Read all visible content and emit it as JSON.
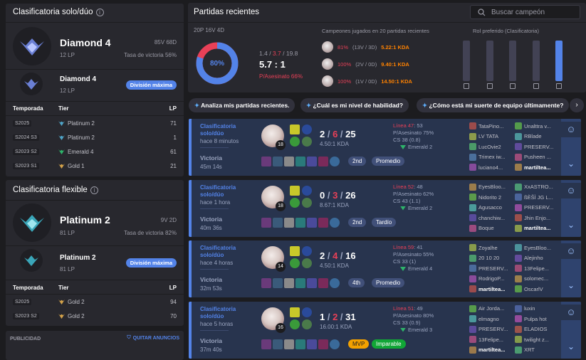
{
  "solo": {
    "title": "Clasificatoria solo/dúo",
    "rank": "Diamond 4",
    "lp": "12 LP",
    "wl": "85V 68D",
    "winrate": "Tasa de victoria 56%",
    "sub_rank": "Diamond 4",
    "sub_lp": "12 LP",
    "badge": "División máxima",
    "headers": {
      "season": "Temporada",
      "tier": "Tier",
      "lp": "LP"
    },
    "seasons": [
      {
        "season": "S2025",
        "tier": "Platinum 2",
        "lp": "71",
        "color": "#4fa3c6"
      },
      {
        "season": "S2024 S3",
        "tier": "Platinum 2",
        "lp": "1",
        "color": "#4fa3c6"
      },
      {
        "season": "S2023 S2",
        "tier": "Emerald 4",
        "lp": "61",
        "color": "#2eb36a"
      },
      {
        "season": "S2023 S1",
        "tier": "Gold 1",
        "lp": "21",
        "color": "#d3a24a"
      }
    ]
  },
  "flex": {
    "title": "Clasificatoria flexible",
    "rank": "Platinum 2",
    "lp": "81 LP",
    "wl": "9V 2D",
    "winrate": "Tasa de victoria 82%",
    "sub_rank": "Platinum 2",
    "sub_lp": "81 LP",
    "badge": "División máxima",
    "headers": {
      "season": "Temporada",
      "tier": "Tier",
      "lp": "LP"
    },
    "seasons": [
      {
        "season": "S2025",
        "tier": "Gold 2",
        "lp": "94",
        "color": "#d3a24a"
      },
      {
        "season": "S2023 S2",
        "tier": "Gold 2",
        "lp": "70",
        "color": "#d3a24a"
      }
    ]
  },
  "ads": {
    "label": "PUBLICIDAD",
    "remove": "QUITAR ANUNCIOS"
  },
  "recent": {
    "title": "Partidas recientes",
    "search_placeholder": "Buscar campeón",
    "record": "20P 16V 4D",
    "winrate": "80%",
    "kills": "1.4",
    "deaths": "3.7",
    "assists": "19.8",
    "kda": "5.7 : 1",
    "kp": "P/Asesinato 66%",
    "champs_title": "Campeones jugados en 20 partidas recientes",
    "champs": [
      {
        "pct": "81%",
        "rec": "(13V / 3D)",
        "kda": "5.22:1 KDA",
        "pct_color": "#e84057",
        "kda_color": "#ff8200"
      },
      {
        "pct": "100%",
        "rec": "(2V / 0D)",
        "kda": "9.40:1 KDA",
        "pct_color": "#e84057",
        "kda_color": "#ff8200"
      },
      {
        "pct": "100%",
        "rec": "(1V / 0D)",
        "kda": "14.50:1 KDA",
        "pct_color": "#e84057",
        "kda_color": "#ff8200"
      }
    ],
    "role_title": "Rol preferido (Clasificatoria)",
    "roles": [
      {
        "name": "top",
        "share": 0
      },
      {
        "name": "jungle",
        "share": 0
      },
      {
        "name": "mid",
        "share": 0
      },
      {
        "name": "adc",
        "share": 0
      },
      {
        "name": "support",
        "share": 1
      }
    ]
  },
  "chips": [
    "Analiza mis partidas recientes.",
    "¿Cuál es mi nivel de habilidad?",
    "¿Cómo está mi suerte de equipo últimamente?"
  ],
  "games": [
    {
      "queue": "Clasificatoria solo/dúo",
      "ago": "hace 8 minutos",
      "result": "Victoria",
      "duration": "45m 14s",
      "level": "18",
      "k": "2",
      "d": "6",
      "a": "25",
      "kda": "4.50:1 KDA",
      "tags": [
        {
          "t": "2nd",
          "bg": "#415079",
          "c": "#fff"
        },
        {
          "t": "Promedio",
          "bg": "#415079",
          "c": "#fff"
        }
      ],
      "line_label": "Línea 47",
      "line_rest": ": 53",
      "kp": "P/Asesinato 75%",
      "cs": "CS 38 (0.8)",
      "rank": "Emerald 2",
      "team1": [
        "TataPino...",
        "LV TATA",
        "LucOvie2",
        "Trimex iw...",
        "luciano4..."
      ],
      "team2": [
        "Unalttra v...",
        "RBlade",
        "PRESERV...",
        "Pusheen ...",
        "martiltea..."
      ]
    },
    {
      "queue": "Clasificatoria solo/dúo",
      "ago": "hace 1 hora",
      "result": "Victoria",
      "duration": "40m 36s",
      "level": "18",
      "k": "0",
      "d": "3",
      "a": "26",
      "kda": "8.67:1 KDA",
      "tags": [
        {
          "t": "2nd",
          "bg": "#415079",
          "c": "#fff"
        },
        {
          "t": "Tardío",
          "bg": "#415079",
          "c": "#fff"
        }
      ],
      "line_label": "Línea 52",
      "line_rest": ": 48",
      "kp": "P/Asesinato 62%",
      "cs": "CS 43 (1.1)",
      "rank": "Emerald 2",
      "team1": [
        "EyesBloo...",
        "Nidorito 2",
        "Agusacco",
        "chanchiw...",
        "Boque"
      ],
      "team2": [
        "XxASTRO...",
        "ßÈŠÌ JG L...",
        "PRESERV...",
        "Jhin Enjo...",
        "martiltea..."
      ]
    },
    {
      "queue": "Clasificatoria solo/dúo",
      "ago": "hace 4 horas",
      "result": "Victoria",
      "duration": "32m 53s",
      "level": "14",
      "k": "2",
      "d": "4",
      "a": "16",
      "kda": "4.50:1 KDA",
      "tags": [
        {
          "t": "4th",
          "bg": "#415079",
          "c": "#fff"
        },
        {
          "t": "Promedio",
          "bg": "#415079",
          "c": "#fff"
        }
      ],
      "line_label": "Línea 59",
      "line_rest": ": 41",
      "kp": "P/Asesinato 55%",
      "cs": "CS 33 (1)",
      "rank": "Emerald 4",
      "team1": [
        "Zoyalhe",
        "20 10 20",
        "PRESERV...",
        "RodrigoP...",
        "martiltea..."
      ],
      "team2": [
        "EyesBloo...",
        "Alejinho",
        "13Felipe...",
        "solomec...",
        "OscarlV"
      ]
    },
    {
      "queue": "Clasificatoria solo/dúo",
      "ago": "hace 5 horas",
      "result": "Victoria",
      "duration": "37m 40s",
      "level": "16",
      "k": "1",
      "d": "2",
      "a": "31",
      "kda": "16.00:1 KDA",
      "tags": [
        {
          "t": "MVP",
          "bg": "#f2a100",
          "c": "#1c1c1f"
        },
        {
          "t": "Imparable",
          "bg": "#11a636",
          "c": "#fff"
        }
      ],
      "line_label": "Línea 51",
      "line_rest": ": 49",
      "kp": "P/Asesinato 80%",
      "cs": "CS 33 (0.9)",
      "rank": "Emerald 3",
      "team1": [
        "Air Jorda...",
        "elmagno",
        "PRESERV...",
        "13Felipe...",
        "martiltea..."
      ],
      "team2": [
        "luxin",
        "Pulpa hot",
        "ELADIOS",
        "twilight z...",
        "XRT"
      ]
    }
  ]
}
